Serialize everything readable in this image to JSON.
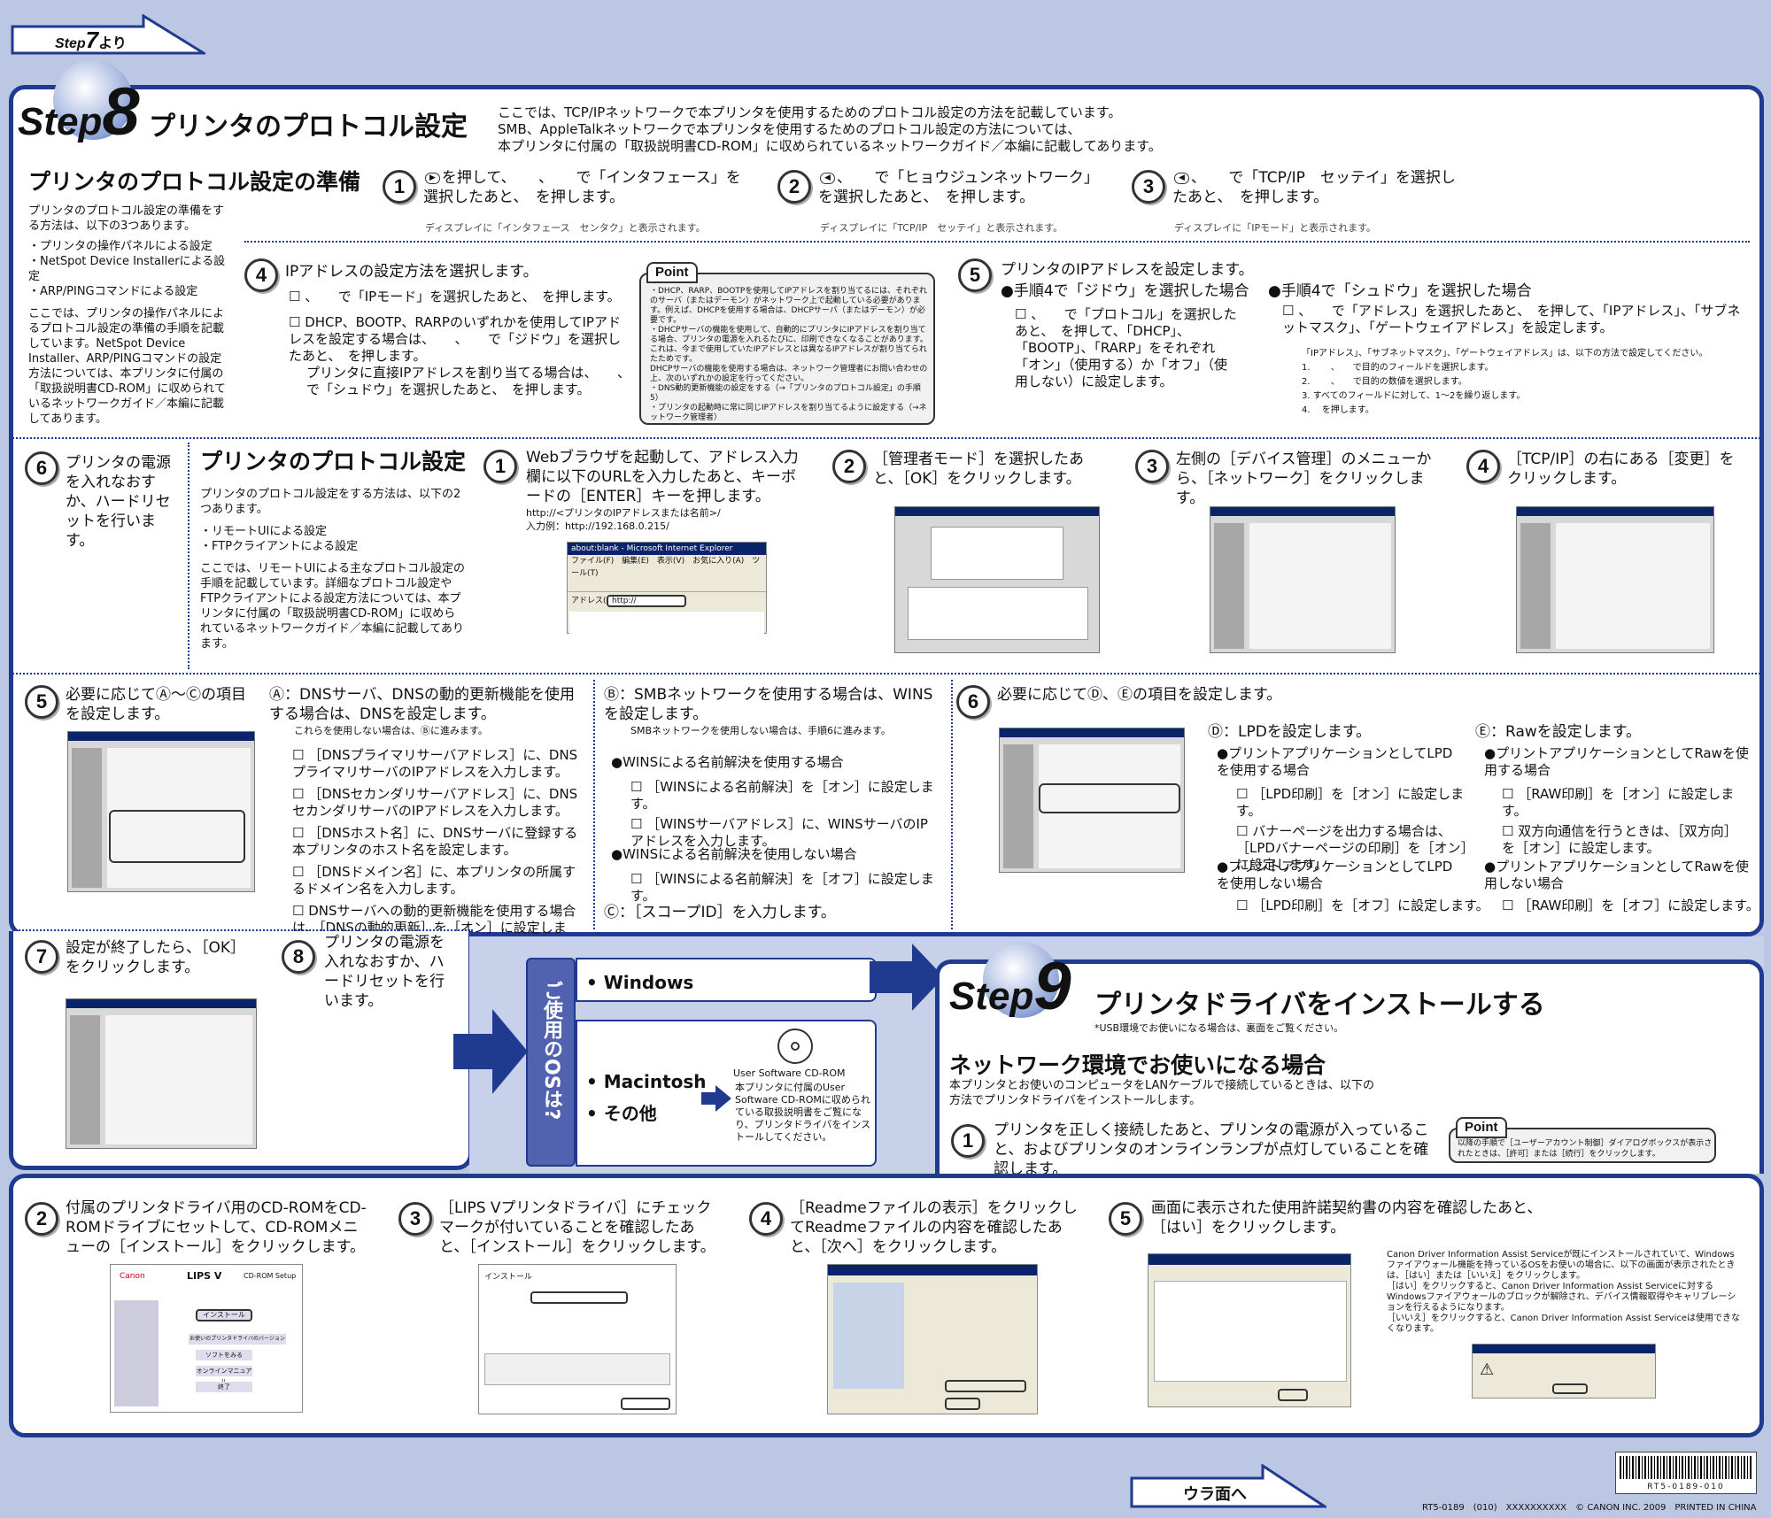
{
  "step7": {
    "label": "7",
    "step": "Step",
    "suffix": "より"
  },
  "step8": {
    "num": "8",
    "step": "Step",
    "title": "プリンタのプロトコル設定",
    "intro": [
      "ここでは、TCP/IPネットワークで本プリンタを使用するためのプロトコル設定の方法を記載しています。",
      "SMB、AppleTalkネットワークで本プリンタを使用するためのプロトコル設定の方法については、",
      "本プリンタに付属の「取扱説明書CD-ROM」に収められているネットワークガイド／本編に記載してあります。"
    ]
  },
  "prep": {
    "title": "プリンタのプロトコル設定の準備",
    "desc": "プリンタのプロトコル設定の準備をする方法は、以下の3つあります。",
    "methods": [
      "・プリンタの操作パネルによる設定",
      "・NetSpot Device Installerによる設定",
      "・ARP/PINGコマンドによる設定"
    ],
    "note": "ここでは、プリンタの操作パネルによるプロトコル設定の準備の手順を記載しています。NetSpot Device Installer、ARP/PINGコマンドの設定方法については、本プリンタに付属の「取扱説明書CD-ROM」に収められているネットワークガイド／本編に記載してあります。"
  },
  "p1": {
    "n": "1",
    "text": "を押して、　　、　　で「インタフェース」を選択したあと、　を押します。",
    "disp": "ディスプレイに「インタフェース　センタク」と表示されます。"
  },
  "p2": {
    "n": "2",
    "text": "、　　で「ヒョウジュンネットワーク」を選択したあと、　を押します。",
    "disp": "ディスプレイに「TCP/IP　セッテイ」と表示されます。"
  },
  "p3": {
    "n": "3",
    "text": "、　　で「TCP/IP　セッテイ」を選択したあと、　を押します。",
    "disp": "ディスプレイに「IPモード」と表示されます。"
  },
  "p4": {
    "n": "4",
    "title": "IPアドレスの設定方法を選択します。",
    "a": "、　　で「IPモード」を選択したあと、　を押します。",
    "b": "DHCP、BOOTP、RARPのいずれかを使用してIPアドレスを設定する場合は、　　、　　で「ジドウ」を選択したあと、　を押します。",
    "c": "プリンタに直接IPアドレスを割り当てる場合は、　　、　　で「シュドウ」を選択したあと、　を押します。"
  },
  "point1": {
    "tag": "Point",
    "lines": [
      "・DHCP、RARP、BOOTPを使用してIPアドレスを割り当てるには、それぞれのサーバ（またはデーモン）がネットワーク上で起動している必要があります。例えば、DHCPを使用する場合は、DHCPサーバ（またはデーモン）が必要です。",
      "・DHCPサーバの機能を使用して、自動的にプリンタにIPアドレスを割り当てる場合、プリンタの電源を入れるたびに、印刷できなくなることがあります。これは、今まで使用していたIPアドレスとは異なるIPアドレスが割り当てられたためです。",
      "DHCPサーバの機能を使用する場合は、ネットワーク管理者にお問い合わせの上、次のいずれかの設定を行ってください。",
      "・DNS動的更新機能の設定をする（→「プリンタのプロトコル設定」の手順5）",
      "・プリンタの起動時に常に同じIPアドレスを割り当てるように設定する（→ネットワーク管理者）"
    ]
  },
  "p5": {
    "n": "5",
    "title": "プリンタのIPアドレスを設定します。",
    "auto_h": "●手順4で「ジドウ」を選択した場合",
    "auto": "、　　で「プロトコル」を選択したあと、　を押して、「DHCP」、「BOOTP」、「RARP」をそれぞれ「オン」（使用する）か「オフ」（使用しない）に設定します。",
    "man_h": "●手順4で「シュドウ」を選択した場合",
    "man": "、　　で「アドレス」を選択したあと、　を押して、「IPアドレス」、「サブネットマスク」、「ゲートウェイアドレス」を設定します。",
    "man_note": [
      "「IPアドレス」、「サブネットマスク」、「ゲートウェイアドレス」は、以下の方法で設定してください。",
      "1. 　　、　　で目的のフィールドを選択します。",
      "2. 　　、　　で目的の数値を選択します。",
      "3. すべてのフィールドに対して、1〜2を繰り返します。",
      "4. 　を押します。"
    ]
  },
  "p6": {
    "n": "6",
    "text": "プリンタの電源を入れなおすか、ハードリセットを行います。"
  },
  "proto": {
    "title": "プリンタのプロトコル設定",
    "desc": "プリンタのプロトコル設定をする方法は、以下の2つあります。",
    "methods": [
      "・リモートUIによる設定",
      "・FTPクライアントによる設定"
    ],
    "note": "ここでは、リモートUIによる主なプロトコル設定の手順を記載しています。詳細なプロトコル設定やFTPクライアントによる設定方法については、本プリンタに付属の「取扱説明書CD-ROM」に収められているネットワークガイド／本編に記載してあります。"
  },
  "r1": {
    "n": "1",
    "text": "Webブラウザを起動して、アドレス入力欄に以下のURLを入力したあと、キーボードの［ENTER］キーを押します。",
    "url": "http://<プリンタのIPアドレスまたは名前>/",
    "ex": "入力例：http://192.168.0.215/",
    "ie_title": "about:blank - Microsoft Internet Explorer",
    "ie_menu": "ファイル(F)　編集(E)　表示(V)　お気に入り(A)　ツール(T)",
    "ie_addr": "アドレス(D)",
    "ie_url": "http://"
  },
  "r2": {
    "n": "2",
    "text": "［管理者モード］を選択したあと、［OK］をクリックします。"
  },
  "r3": {
    "n": "3",
    "text": "左側の［デバイス管理］のメニューから、［ネットワーク］をクリックします。"
  },
  "r4": {
    "n": "4",
    "text": "［TCP/IP］の右にある［変更］をクリックします。"
  },
  "r5": {
    "n": "5",
    "text": "必要に応じてⒶ〜Ⓒの項目を設定します。"
  },
  "A": {
    "h": "Ⓐ：DNSサーバ、DNSの動的更新機能を使用する場合は、DNSを設定します。",
    "skip": "これらを使用しない場合は、Ⓑに進みます。",
    "items": [
      "［DNSプライマリサーバアドレス］に、DNSプライマリサーバのIPアドレスを入力します。",
      "［DNSセカンダリサーバアドレス］に、DNSセカンダリサーバのIPアドレスを入力します。",
      "［DNSホスト名］に、DNSサーバに登録する本プリンタのホスト名を設定します。",
      "［DNSドメイン名］に、本プリンタの所属するドメイン名を入力します。",
      "DNSサーバへの動的更新機能を使用する場合は、［DNSの動的更新］を［オン］に設定します。"
    ]
  },
  "B": {
    "h": "Ⓑ：SMBネットワークを使用する場合は、WINSを設定します。",
    "skip": "SMBネットワークを使用しない場合は、手順6に進みます。",
    "use_h": "●WINSによる名前解決を使用する場合",
    "use": [
      "［WINSによる名前解決］を［オン］に設定します。",
      "［WINSサーバアドレス］に、WINSサーバのIPアドレスを入力します。"
    ],
    "nouse_h": "●WINSによる名前解決を使用しない場合",
    "nouse": [
      "［WINSによる名前解決］を［オフ］に設定します。"
    ]
  },
  "C": {
    "h": "Ⓒ：［スコープID］を入力します。"
  },
  "r6": {
    "n": "6",
    "text": "必要に応じてⒹ、Ⓔの項目を設定します。"
  },
  "D": {
    "h": "Ⓓ：LPDを設定します。",
    "use_h": "●プリントアプリケーションとしてLPDを使用する場合",
    "use": [
      "［LPD印刷］を［オン］に設定します。",
      "バナーページを出力する場合は、［LPDバナーページの印刷］を［オン］に設定します。"
    ],
    "nouse_h": "●プリントアプリケーションとしてLPDを使用しない場合",
    "nouse": [
      "［LPD印刷］を［オフ］に設定します。"
    ]
  },
  "E": {
    "h": "Ⓔ：Rawを設定します。",
    "use_h": "●プリントアプリケーションとしてRawを使用する場合",
    "use": [
      "［RAW印刷］を［オン］に設定します。",
      "双方向通信を行うときは、［双方向］を［オン］に設定します。"
    ],
    "nouse_h": "●プリントアプリケーションとしてRawを使用しない場合",
    "nouse": [
      "［RAW印刷］を［オフ］に設定します。"
    ]
  },
  "r7": {
    "n": "7",
    "text": "設定が終了したら、［OK］をクリックします。"
  },
  "r8": {
    "n": "8",
    "text": "プリンタの電源を入れなおすか、ハードリセットを行います。"
  },
  "os": {
    "question": "ご使用のOSは?",
    "windows": "• Windows",
    "mac": "• Macintosh",
    "other": "• その他",
    "cd_title": "User Software CD-ROM",
    "cd_text": "本プリンタに付属のUser Software CD-ROMに収められている取扱説明書をご覧になり、プリンタドライバをインストールしてください。"
  },
  "step9": {
    "num": "9",
    "step": "Step",
    "title": "プリンタドライバをインストールする",
    "usb": "*USB環境でお使いになる場合は、裏面をご覧ください。",
    "net_title": "ネットワーク環境でお使いになる場合",
    "net_desc": "本プリンタとお使いのコンピュータをLANケーブルで接続しているときは、以下の方法でプリンタドライバをインストールします。",
    "s1n": "1",
    "s1": "プリンタを正しく接続したあと、プリンタの電源が入っていること、およびプリンタのオンラインランプが点灯していることを確認します。",
    "point_tag": "Point",
    "point": "以降の手順で［ユーザーアカウント制御］ダイアログボックスが表示されたときは、［許可］または［続行］をクリックします。"
  },
  "i2": {
    "n": "2",
    "text": "付属のプリンタドライバ用のCD-ROMをCD-ROMドライブにセットして、CD-ROMメニューの［インストール］をクリックします。",
    "brand": "Canon",
    "product": "LIPS V",
    "setup": "CD-ROM Setup",
    "btns": [
      "インストール",
      "お使いのプリンタドライバのバージョン",
      "ソフトをみる",
      "オンラインマニュアル",
      "終了"
    ]
  },
  "i3": {
    "n": "3",
    "text": "［LIPS Vプリンタドライバ］にチェックマークが付いていることを確認したあと、［インストール］をクリックします。",
    "head": "インストール"
  },
  "i4": {
    "n": "4",
    "text": "［Readmeファイルの表示］をクリックしてReadmeファイルの内容を確認したあと、［次へ］をクリックします。"
  },
  "i5": {
    "n": "5",
    "text": "画面に表示された使用許諾契約書の内容を確認したあと、［はい］をクリックします。",
    "note": [
      "Canon Driver Information Assist Serviceが既にインストールされていて、Windowsファイアウォール機能を持っているOSをお使いの場合に、以下の画面が表示されたときは、［はい］または［いいえ］をクリックします。",
      "［はい］をクリックすると、Canon Driver Information Assist Serviceに対するWindowsファイアウォールのブロックが解除され、デバイス情報取得やキャリブレーションを行えるようになります。",
      "［いいえ］をクリックすると、Canon Driver Information Assist Serviceは使用できなくなります。"
    ]
  },
  "ura": "ウラ面へ",
  "barcode": "RT5-0189-010",
  "footer": "RT5-0189　(010)　XXXXXXXXXX　© CANON INC. 2009　PRINTED IN CHINA",
  "colors": {
    "navy": "#1f3a8f",
    "bg": "#bcc7e4"
  }
}
